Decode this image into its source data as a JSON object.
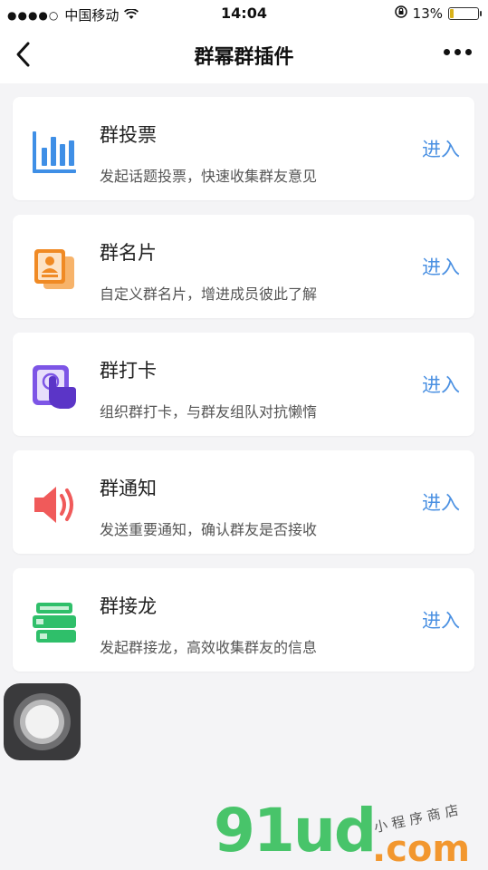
{
  "status_bar": {
    "carrier": "中国移动",
    "time": "14:04",
    "battery_percent": "13%",
    "battery_level": 0.13,
    "signal_icon": "signal-dots-icon",
    "wifi_icon": "wifi-icon",
    "lock_icon": "orientation-lock-icon"
  },
  "nav": {
    "title": "群幂群插件",
    "back_icon": "back-chevron-icon",
    "more_icon": "more-dots-icon"
  },
  "plugins": [
    {
      "name": "群投票",
      "desc": "发起话题投票，快速收集群友意见",
      "action": "进入",
      "icon": "bar-chart-icon",
      "color": "#3f8fe6"
    },
    {
      "name": "群名片",
      "desc": "自定义群名片，增进成员彼此了解",
      "action": "进入",
      "icon": "contact-card-icon",
      "color": "#f08a24"
    },
    {
      "name": "群打卡",
      "desc": "组织群打卡，与群友组队对抗懒惰",
      "action": "进入",
      "icon": "tap-hand-icon",
      "color": "#7d55e6"
    },
    {
      "name": "群通知",
      "desc": "发送重要通知，确认群友是否接收",
      "action": "进入",
      "icon": "speaker-icon",
      "color": "#f05a5a"
    },
    {
      "name": "群接龙",
      "desc": "发起群接龙，高效收集群友的信息",
      "action": "进入",
      "icon": "relay-cards-icon",
      "color": "#2fbf6a"
    }
  ],
  "watermark": {
    "brand": "91ud",
    "domain": ".com",
    "tagline": "小程序商店"
  },
  "colors": {
    "accent": "#4a90e2",
    "background": "#f4f4f6"
  }
}
